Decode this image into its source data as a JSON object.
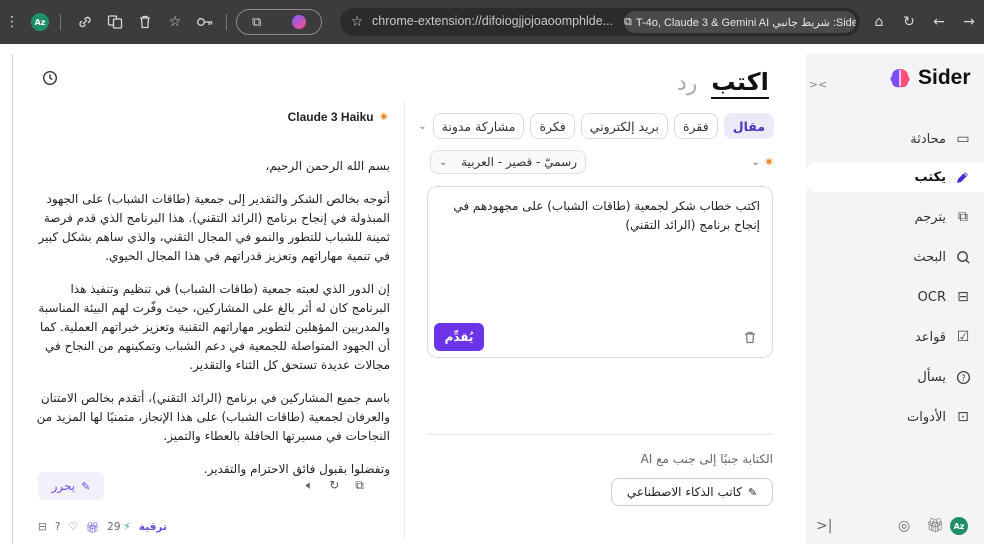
{
  "browser": {
    "url": "chrome-extension://difoiogjjojoaoomphlde...",
    "tab_chip_title": "Sider: شريط جانبي T-4o, Claude 3 & Gemini AI",
    "profile_initials": "Az"
  },
  "sidebar": {
    "brand": "Sider",
    "items": [
      {
        "label": "محادثة",
        "icon": "chat-icon"
      },
      {
        "label": "يكتب",
        "icon": "pen-icon"
      },
      {
        "label": "يترجم",
        "icon": "translate-icon"
      },
      {
        "label": "البحث",
        "icon": "search-icon"
      },
      {
        "label": "OCR",
        "icon": "ocr-icon"
      },
      {
        "label": "قواعد",
        "icon": "grammar-icon"
      },
      {
        "label": "يسأل",
        "icon": "question-icon"
      },
      {
        "label": "الأدوات",
        "icon": "tools-icon"
      }
    ],
    "active_index": 1,
    "user_initials": "Az"
  },
  "composer": {
    "tabs": {
      "write": "اكتب",
      "reply": "رد"
    },
    "types": [
      "مقال",
      "فقرة",
      "بريد إلكتروني",
      "فكرة",
      "مشاركة مدونة"
    ],
    "active_type": "مقال",
    "format": "رسميّ - قصير - العربية",
    "prompt": "اكتب خطاب شكر لجمعية (طاقات الشباب) على مجهودهم في إنجاح برنامج (الرائد التقني)",
    "send_label": "يُقدِّم",
    "ai_caption": "الكتابة جنبًا إلى جنب مع AI",
    "ai_button": "كاتب الذكاء الاصطناعي"
  },
  "output": {
    "model": "Claude 3 Haiku",
    "paragraphs": [
      "بسم الله الرحمن الرحيم،",
      "أتوجه بخالص الشكر والتقدير إلى جمعية (طاقات الشباب) على الجهود المبذولة في إنجاح برنامج (الرائد التقني). هذا البرنامج الذي قدم فرصة ثمينة للشباب للتطور والنمو في المجال التقني، والذي ساهم بشكل كبير في تنمية مهاراتهم وتعزيز قدراتهم في هذا المجال الحيوي.",
      "إن الدور الذي لعبته جمعية (طاقات الشباب) في تنظيم وتنفيذ هذا البرنامج كان له أثر بالغ على المشاركين، حيث وفّرت لهم البيئة المناسبة والمدربين المؤهلين لتطوير مهاراتهم التقنية وتعزيز خبراتهم العملية. كما أن الجهود المتواصلة للجمعية في دعم الشباب وتمكينهم من النجاح في مجالات عديدة تستحق كل الثناء والتقدير.",
      "باسم جميع المشاركين في برنامج (الرائد التقني)، أتقدم بخالص الامتنان والعرفان لجمعية (طاقات الشباب) على هذا الإنجاز، متمنيًا لها المزيد من النجاحات في مسيرتها الحافلة بالعطاء والتميز.",
      "وتفضلوا بقبول فائق الاحترام والتقدير."
    ],
    "edit_label": "يحرر",
    "credits": "29",
    "upgrade": "ترقية"
  },
  "colors": {
    "accent": "#6b34e8",
    "active_pill_bg": "#ece9fb",
    "chrome_bar": "#3c3c3c",
    "sidebar_bg": "#f4f4f6"
  }
}
